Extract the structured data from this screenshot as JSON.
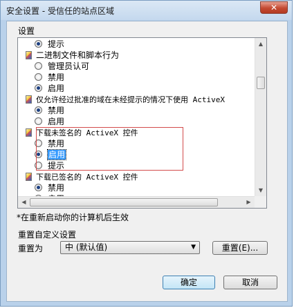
{
  "window": {
    "title": "安全设置 - 受信任的站点区域",
    "close_glyph": "✕"
  },
  "settings_label": "设置",
  "tree": [
    {
      "type": "option",
      "label": "提示",
      "checked": true
    },
    {
      "type": "setting",
      "label": "二进制文件和脚本行为"
    },
    {
      "type": "option",
      "label": "管理员认可",
      "checked": false
    },
    {
      "type": "option",
      "label": "禁用",
      "checked": false
    },
    {
      "type": "option",
      "label": "启用",
      "checked": true
    },
    {
      "type": "setting",
      "label": "仅允许经过批准的域在未经提示的情况下使用 ActiveX"
    },
    {
      "type": "option",
      "label": "禁用",
      "checked": true
    },
    {
      "type": "option",
      "label": "启用",
      "checked": false
    },
    {
      "type": "setting",
      "label": "下载未签名的 ActiveX 控件"
    },
    {
      "type": "option",
      "label": "禁用",
      "checked": false
    },
    {
      "type": "option",
      "label": "启用",
      "checked": true,
      "selected": true
    },
    {
      "type": "option",
      "label": "提示",
      "checked": false
    },
    {
      "type": "setting",
      "label": "下载已签名的 ActiveX 控件"
    },
    {
      "type": "option",
      "label": "禁用",
      "checked": true
    },
    {
      "type": "option",
      "label": "启用",
      "checked": false
    }
  ],
  "note": "*在重新启动你的计算机后生效",
  "reset_section": {
    "title": "重置自定义设置",
    "reset_to_label": "重置为",
    "dropdown_value": "中 (默认值)",
    "reset_button": "重置(E)..."
  },
  "buttons": {
    "ok": "确定",
    "cancel": "取消"
  },
  "colors": {
    "highlight_border": "#d24a4a",
    "selection": "#3399ff"
  }
}
